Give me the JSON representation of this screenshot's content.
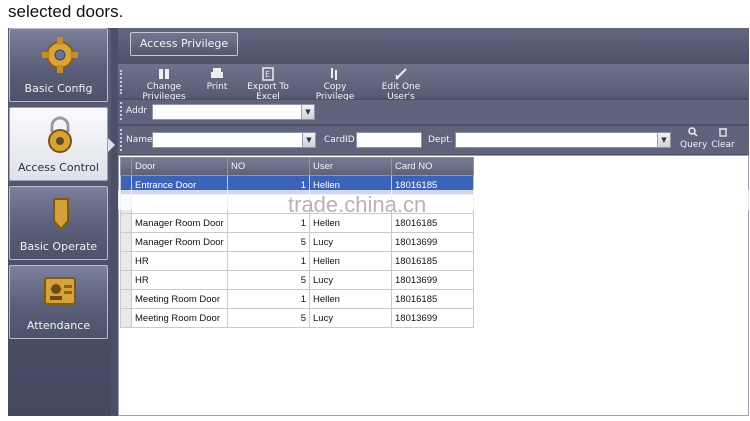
{
  "caption": "selected doors.",
  "watermark": "trade.china.cn",
  "nav": {
    "items": [
      {
        "label": "Basic Config",
        "icon": "gear-icon",
        "active": false
      },
      {
        "label": "Access Control",
        "icon": "padlock-icon",
        "active": true
      },
      {
        "label": "Basic Operate",
        "icon": "operate-icon",
        "active": false
      },
      {
        "label": "Attendance",
        "icon": "attendance-card-icon",
        "active": false
      }
    ]
  },
  "title_tab": "Access Privilege",
  "toolbar": [
    {
      "label": "Change Privileges",
      "icon": "change-privileges-icon"
    },
    {
      "label": "Print",
      "icon": "printer-icon"
    },
    {
      "label": "Export To Excel",
      "icon": "excel-icon"
    },
    {
      "label": "Copy Privilege",
      "icon": "copy-icon"
    },
    {
      "label": "Edit One User's",
      "icon": "edit-icon"
    }
  ],
  "filters": {
    "addr_label": "Addr",
    "addr_value": "",
    "name_label": "Name",
    "name_value": "",
    "cardid_label": "CardID",
    "cardid_value": "",
    "dept_label": "Dept.",
    "dept_value": "",
    "query_label": "Query",
    "clear_label": "Clear"
  },
  "grid": {
    "columns": [
      "Door",
      "NO",
      "User",
      "Card NO"
    ],
    "rows": [
      {
        "door": "Entrance Door",
        "no": "1",
        "user": "Hellen",
        "card": "18016185",
        "selected": true
      },
      {
        "door": "",
        "no": "",
        "user": "",
        "card": "",
        "selected": false
      },
      {
        "door": "Manager Room Door",
        "no": "1",
        "user": "Hellen",
        "card": "18016185",
        "selected": false
      },
      {
        "door": "Manager Room Door",
        "no": "5",
        "user": "Lucy",
        "card": "18013699",
        "selected": false
      },
      {
        "door": "HR",
        "no": "1",
        "user": "Hellen",
        "card": "18016185",
        "selected": false
      },
      {
        "door": "HR",
        "no": "5",
        "user": "Lucy",
        "card": "18013699",
        "selected": false
      },
      {
        "door": "Meeting Room Door",
        "no": "1",
        "user": "Hellen",
        "card": "18016185",
        "selected": false
      },
      {
        "door": "Meeting Room Door",
        "no": "5",
        "user": "Lucy",
        "card": "18013699",
        "selected": false
      }
    ]
  },
  "colors": {
    "accent": "#3d63b9",
    "chrome": "#4b4f68"
  }
}
